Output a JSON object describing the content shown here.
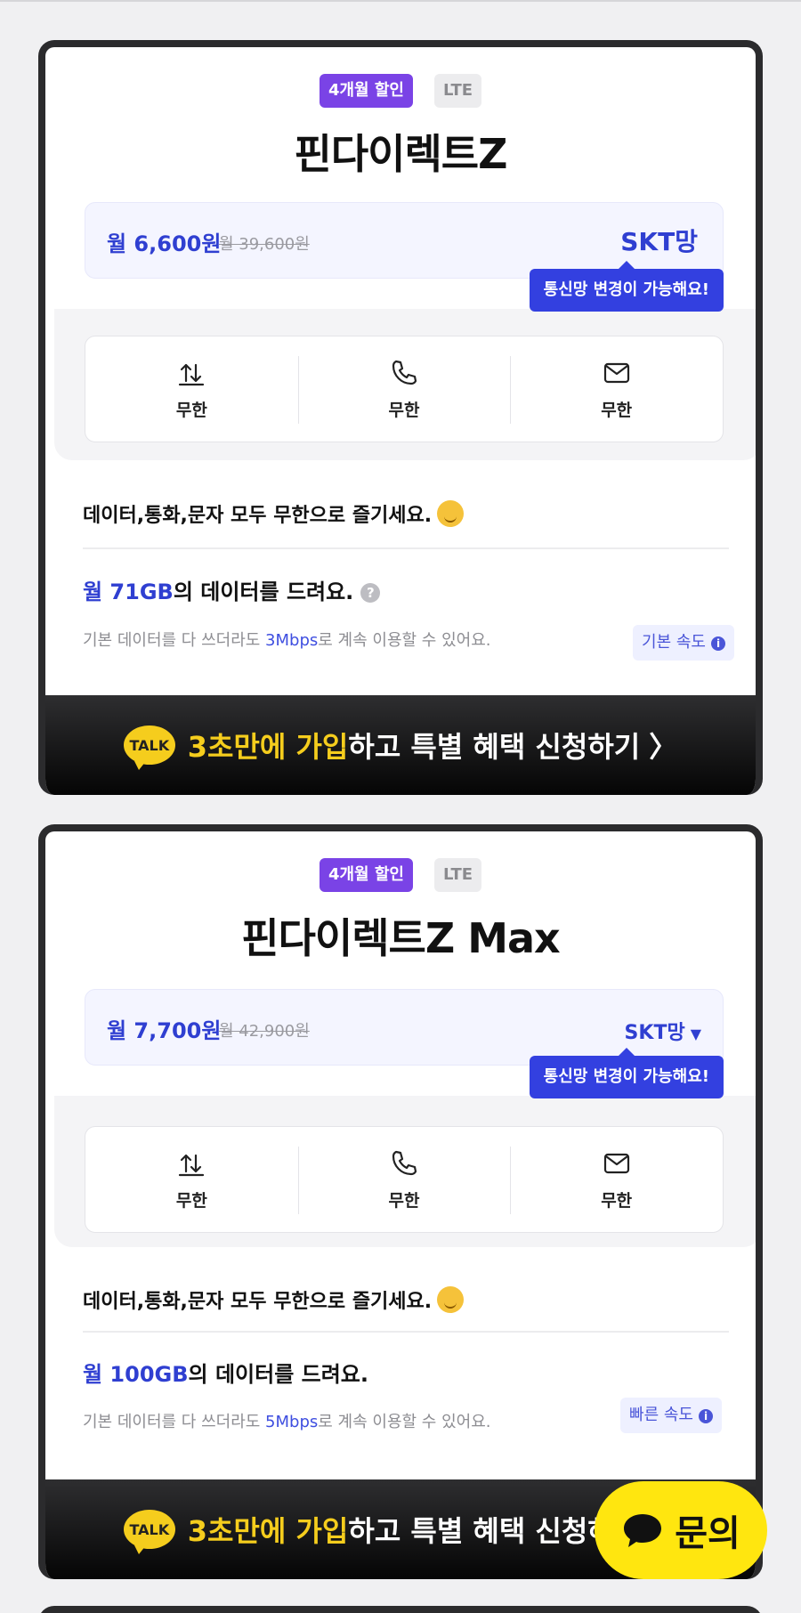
{
  "plans": [
    {
      "badge_discount": "4개월 할인",
      "badge_network_type": "LTE",
      "name": "핀다이렉트Z",
      "price": "월 6,600원",
      "original_price": "월 39,600원",
      "network": "SKT망",
      "network_dropdown": false,
      "tooltip": "통신망 변경이 가능해요!",
      "features": [
        {
          "icon": "data-arrows-icon",
          "label": "무한"
        },
        {
          "icon": "phone-icon",
          "label": "무한"
        },
        {
          "icon": "mail-icon",
          "label": "무한"
        }
      ],
      "description": "데이터,통화,문자 모두 무한으로 즐기세요.",
      "data_prefix": "월 71GB",
      "data_suffix": "의 데이터를 드려요.",
      "help_symbol": "?",
      "sub_prefix": "기본 데이터를 다 쓰더라도 ",
      "sub_speed": "3Mbps",
      "sub_suffix": "로 계속 이용할 수 있어요.",
      "speed_tag": "기본 속도",
      "cta_talk": "TALK",
      "cta_highlight": "3초만에 가입",
      "cta_rest": "하고 특별 혜택 신청하기",
      "cta_chevron": "〉"
    },
    {
      "badge_discount": "4개월 할인",
      "badge_network_type": "LTE",
      "name": "핀다이렉트Z Max",
      "price": "월 7,700원",
      "original_price": "월 42,900원",
      "network": "SKT망",
      "network_dropdown": true,
      "tooltip": "통신망 변경이 가능해요!",
      "features": [
        {
          "icon": "data-arrows-icon",
          "label": "무한"
        },
        {
          "icon": "phone-icon",
          "label": "무한"
        },
        {
          "icon": "mail-icon",
          "label": "무한"
        }
      ],
      "description": "데이터,통화,문자 모두 무한으로 즐기세요.",
      "data_prefix": "월 100GB",
      "data_suffix": "의 데이터를 드려요.",
      "sub_prefix": "기본 데이터를 다 쓰더라도 ",
      "sub_speed": "5Mbps",
      "sub_suffix": "로 계속 이용할 수 있어요.",
      "speed_tag": "빠른 속도",
      "cta_talk": "TALK",
      "cta_highlight": "3초만에 가입",
      "cta_rest": "하고 특별 혜택 신청하기",
      "cta_chevron": "〉"
    }
  ],
  "info_symbol": "i",
  "dropdown_symbol": "▼",
  "inquiry_button": {
    "label": "문의",
    "icon": "chat-bubble-icon"
  },
  "colors": {
    "accent": "#2f3fd1",
    "discount_badge": "#7a43e6",
    "tooltip": "#3340e0",
    "kakao_yellow": "#f5cd1d",
    "inquiry_yellow": "#ffe60f"
  }
}
